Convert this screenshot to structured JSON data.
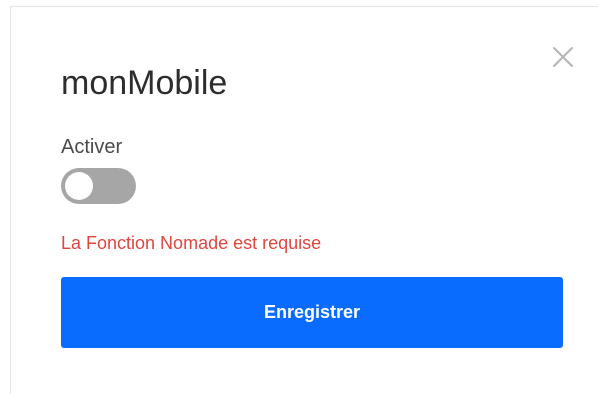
{
  "modal": {
    "title": "monMobile",
    "toggle": {
      "label": "Activer",
      "state": "off"
    },
    "error_message": "La Fonction Nomade est requise",
    "save_label": "Enregistrer",
    "close_icon": "close-icon"
  },
  "colors": {
    "primary": "#0a6cff",
    "error": "#e0463d",
    "toggle_off": "#a6a6a6",
    "title": "#2d2d2d"
  }
}
